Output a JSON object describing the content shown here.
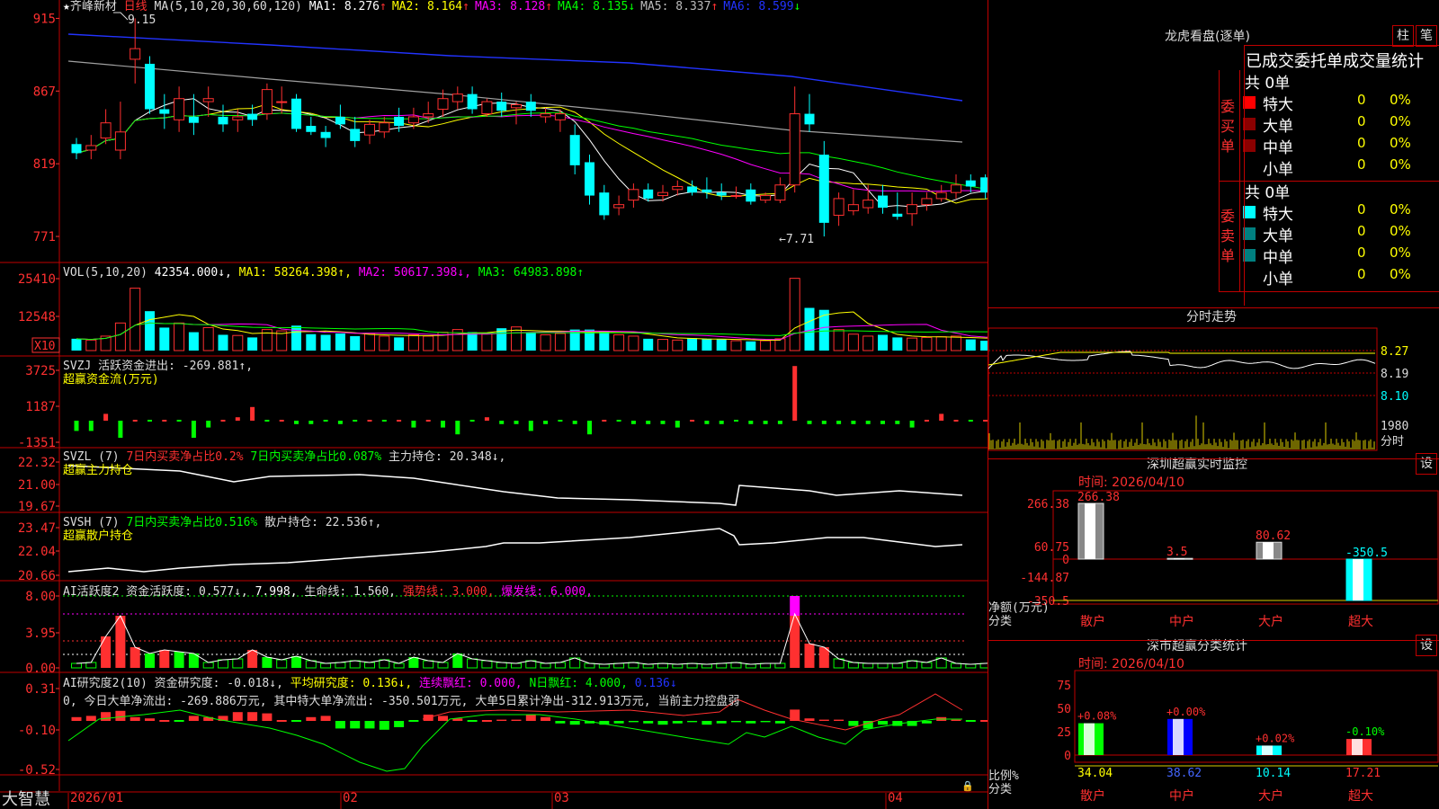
{
  "colors": {
    "up": "#ff3030",
    "down": "#00ffff",
    "border": "#c00000",
    "yellow": "#ffff00",
    "magenta": "#ff00ff",
    "green": "#00ff00",
    "white": "#ffffff",
    "blue": "#2233ff",
    "gray": "#a0a0a0"
  },
  "header": {
    "star": "★",
    "stock_name": "齐峰新材",
    "period": "日线",
    "ma_params": "MA(5,10,20,30,60,120)",
    "ma": [
      {
        "label": "MA1:",
        "value": "8.276",
        "arrow": "↑",
        "color": "#ffffff"
      },
      {
        "label": "MA2:",
        "value": "8.164",
        "arrow": "↑",
        "color": "#ffff00"
      },
      {
        "label": "MA3:",
        "value": "8.128",
        "arrow": "↑",
        "color": "#ff00ff"
      },
      {
        "label": "MA4:",
        "value": "8.135",
        "arrow": "↓",
        "color": "#00ff00"
      },
      {
        "label": "MA5:",
        "value": "8.337",
        "arrow": "↑",
        "color": "#bbbbbb"
      },
      {
        "label": "MA6:",
        "value": "8.599",
        "arrow": "↓",
        "color": "#2233ff"
      }
    ]
  },
  "axes": {
    "price_ticks": [
      "915",
      "867",
      "819",
      "771"
    ],
    "vol_ticks": [
      "25410",
      "12548"
    ],
    "vol_unit": "X10",
    "svzj_ticks": [
      "3725",
      "1187",
      "-1351"
    ],
    "svzl_ticks": [
      "22.32",
      "21.00",
      "19.67"
    ],
    "svsh_ticks": [
      "23.47",
      "22.04",
      "20.66"
    ],
    "ai_ticks": [
      "8.00",
      "3.95",
      "0.00"
    ],
    "ai2_ticks": [
      "0.31",
      "-0.10",
      "-0.52"
    ],
    "dates": [
      "2026/01",
      "02",
      "03",
      "04"
    ]
  },
  "annotations": {
    "high": "9.15",
    "low": "←7.71"
  },
  "panels": {
    "vol": {
      "params": "VOL(5,10,20)",
      "value": "42354.000↓,",
      "ma": [
        {
          "t": "MA1: 58264.398↑,",
          "c": "#ffff00"
        },
        {
          "t": "MA2: 50617.398↓,",
          "c": "#ff00ff"
        },
        {
          "t": "MA3: 64983.898↑",
          "c": "#00ff00"
        }
      ]
    },
    "svzj": {
      "line1": "SVZJ  活跃资金进出: -269.881↑,",
      "line2": "超赢资金流(万元)"
    },
    "svzl": {
      "p1": "SVZL (7)",
      "p2": "7日内买卖净占比0.2%",
      "p3": "7日内买卖净占比0.087%",
      "p4": "主力持仓: 20.348↓,",
      "line2": "超赢主力持仓"
    },
    "svsh": {
      "p1": "SVSH (7)",
      "p2": "7日内买卖净占比0.516%",
      "p3": "散户持仓: 22.536↑,",
      "line2": "超赢散户持仓"
    },
    "ai": {
      "p1": "AI活跃度2",
      "p2": "资金活跃度: 0.577↓,",
      "p3": "7.998,",
      "p4": "生命线: 1.560,",
      "p5": "强势线: 3.000,",
      "p6": "爆发线: 6.000,"
    },
    "ai2": {
      "p1": "AI研究度2(10)",
      "p2": "资金研究度: -0.018↓,",
      "p3": "平均研究度: 0.136↓,",
      "p4": "连续飘红: 0.000,",
      "p5": "N日飘红: 4.000,",
      "p6": "0.136↓",
      "line2": "0, 今日大单净流出: -269.886万元, 其中特大单净流出: -350.501万元, 大单5日累计净出-312.913万元, 当前主力控盘弱"
    }
  },
  "footer": {
    "brand": "大智慧"
  },
  "right": {
    "lhb": {
      "title": "龙虎看盘(逐单)",
      "btn1": "柱",
      "btn2": "笔",
      "tabs": "已成交委托单成交量统计",
      "buy": {
        "label": "委买单",
        "total": "共 0单",
        "rows": [
          {
            "name": "特大",
            "v": "0",
            "p": "0%"
          },
          {
            "name": "大单",
            "v": "0",
            "p": "0%"
          },
          {
            "name": "中单",
            "v": "0",
            "p": "0%"
          },
          {
            "name": "小单",
            "v": "0",
            "p": "0%"
          }
        ]
      },
      "sell": {
        "label": "委卖单",
        "total": "共 0单",
        "rows": [
          {
            "name": "特大",
            "v": "0",
            "p": "0%"
          },
          {
            "name": "大单",
            "v": "0",
            "p": "0%"
          },
          {
            "name": "中单",
            "v": "0",
            "p": "0%"
          },
          {
            "name": "小单",
            "v": "0",
            "p": "0%"
          }
        ]
      }
    },
    "fenshi": {
      "title": "分时走势",
      "ticks": [
        "8.27",
        "8.19",
        "8.10"
      ],
      "vol": "1980",
      "vol_label": "分时"
    },
    "szmon": {
      "title": "深圳超赢实时监控",
      "btn": "设",
      "time": "时间: 2026/04/10",
      "ylabels": [
        "266.38",
        "60.75",
        "0",
        "-144.87",
        "-350.5"
      ],
      "bars": [
        {
          "label": "266.38",
          "value": 266.38
        },
        {
          "label": "3.5",
          "value": 3.5
        },
        {
          "label": "80.62",
          "value": 80.62
        },
        {
          "label": "-350.5",
          "value": -350.5
        }
      ],
      "ylab1": "净额(万元)",
      "ylab2": "分类",
      "cats": [
        "散户",
        "中户",
        "大户",
        "超大"
      ]
    },
    "szstat": {
      "title": "深市超赢分类统计",
      "btn": "设",
      "time": "时间: 2026/04/10",
      "ylabels": [
        "75",
        "50",
        "25",
        "0"
      ],
      "bars": [
        {
          "pct": "+0.08%",
          "value": 34.04,
          "label": "34.04"
        },
        {
          "pct": "+0.00%",
          "value": 38.62,
          "label": "38.62"
        },
        {
          "pct": "+0.02%",
          "value": 10.14,
          "label": "10.14"
        },
        {
          "pct": "-0.10%",
          "value": 17.21,
          "label": "17.21"
        }
      ],
      "ylab1": "比例%",
      "ylab2": "分类",
      "cats": [
        "散户",
        "中户",
        "大户",
        "超大"
      ]
    }
  },
  "chart_data": [
    {
      "type": "candlestick",
      "title": "齐峰新材 日线",
      "y_range": [
        7.55,
        9.2
      ],
      "ohlc": [
        [
          8.32,
          8.36,
          8.22,
          8.26
        ],
        [
          8.28,
          8.38,
          8.22,
          8.31
        ],
        [
          8.36,
          8.55,
          8.32,
          8.46
        ],
        [
          8.28,
          8.6,
          8.22,
          8.4
        ],
        [
          8.88,
          9.15,
          8.72,
          8.95
        ],
        [
          8.85,
          8.9,
          8.52,
          8.55
        ],
        [
          8.55,
          8.65,
          8.42,
          8.52
        ],
        [
          8.48,
          8.7,
          8.4,
          8.62
        ],
        [
          8.5,
          8.65,
          8.38,
          8.46
        ],
        [
          8.6,
          8.7,
          8.5,
          8.62
        ],
        [
          8.5,
          8.58,
          8.4,
          8.45
        ],
        [
          8.48,
          8.55,
          8.4,
          8.5
        ],
        [
          8.52,
          8.58,
          8.44,
          8.48
        ],
        [
          8.52,
          8.72,
          8.48,
          8.68
        ],
        [
          8.6,
          8.7,
          8.52,
          8.6
        ],
        [
          8.62,
          8.65,
          8.4,
          8.42
        ],
        [
          8.44,
          8.5,
          8.38,
          8.4
        ],
        [
          8.4,
          8.44,
          8.3,
          8.36
        ],
        [
          8.5,
          8.58,
          8.42,
          8.45
        ],
        [
          8.42,
          8.5,
          8.3,
          8.34
        ],
        [
          8.38,
          8.48,
          8.32,
          8.45
        ],
        [
          8.4,
          8.5,
          8.36,
          8.46
        ],
        [
          8.5,
          8.56,
          8.4,
          8.44
        ],
        [
          8.46,
          8.56,
          8.42,
          8.5
        ],
        [
          8.5,
          8.6,
          8.46,
          8.52
        ],
        [
          8.55,
          8.68,
          8.5,
          8.62
        ],
        [
          8.6,
          8.7,
          8.55,
          8.65
        ],
        [
          8.65,
          8.7,
          8.52,
          8.55
        ],
        [
          8.52,
          8.62,
          8.5,
          8.6
        ],
        [
          8.6,
          8.66,
          8.5,
          8.54
        ],
        [
          8.56,
          8.6,
          8.45,
          8.58
        ],
        [
          8.6,
          8.65,
          8.5,
          8.54
        ],
        [
          8.5,
          8.56,
          8.46,
          8.52
        ],
        [
          8.48,
          8.55,
          8.4,
          8.52
        ],
        [
          8.38,
          8.45,
          8.12,
          8.18
        ],
        [
          8.2,
          8.25,
          7.92,
          7.98
        ],
        [
          8.0,
          8.05,
          7.82,
          7.85
        ],
        [
          7.9,
          7.98,
          7.85,
          7.92
        ],
        [
          7.95,
          8.06,
          7.9,
          8.02
        ],
        [
          8.02,
          8.06,
          7.94,
          7.96
        ],
        [
          7.98,
          8.05,
          7.94,
          8.0
        ],
        [
          8.02,
          8.08,
          7.98,
          8.04
        ],
        [
          8.04,
          8.08,
          7.98,
          8.0
        ],
        [
          8.02,
          8.1,
          7.96,
          8.0
        ],
        [
          8.0,
          8.06,
          7.95,
          7.98
        ],
        [
          7.98,
          8.04,
          7.96,
          7.98
        ],
        [
          8.02,
          8.06,
          7.92,
          7.94
        ],
        [
          7.95,
          8.0,
          7.93,
          7.98
        ],
        [
          7.95,
          8.1,
          7.93,
          8.05
        ],
        [
          8.05,
          8.7,
          8.0,
          8.52
        ],
        [
          8.52,
          8.65,
          8.4,
          8.45
        ],
        [
          8.25,
          8.34,
          7.71,
          7.8
        ],
        [
          7.85,
          8.0,
          7.78,
          7.96
        ],
        [
          7.88,
          8.02,
          7.85,
          7.92
        ],
        [
          7.9,
          8.05,
          7.86,
          7.95
        ],
        [
          7.98,
          8.05,
          7.86,
          7.9
        ],
        [
          7.86,
          8.0,
          7.82,
          7.84
        ],
        [
          7.86,
          8.0,
          7.78,
          7.92
        ],
        [
          7.92,
          8.0,
          7.88,
          7.96
        ],
        [
          7.96,
          8.05,
          7.94,
          8.0
        ],
        [
          8.0,
          8.12,
          7.96,
          8.05
        ],
        [
          8.08,
          8.12,
          8.0,
          8.04
        ],
        [
          8.1,
          8.12,
          7.96,
          8.0
        ],
        [
          8.04,
          8.14,
          7.9,
          8.02
        ],
        [
          8.06,
          8.2,
          8.02,
          8.12
        ],
        [
          8.12,
          8.22,
          8.05,
          8.15
        ],
        [
          8.15,
          8.45,
          8.1,
          8.25
        ],
        [
          8.25,
          8.3,
          8.15,
          8.2
        ],
        [
          8.3,
          8.4,
          8.18,
          8.22
        ],
        [
          8.32,
          8.38,
          8.05,
          8.1
        ],
        [
          8.1,
          8.22,
          8.08,
          8.18
        ]
      ],
      "volume": [
        1800,
        1600,
        2200,
        4200,
        9500,
        6000,
        3500,
        4200,
        2800,
        3500,
        2400,
        2300,
        2000,
        3200,
        3000,
        3800,
        2500,
        2400,
        2600,
        2200,
        2600,
        2200,
        2000,
        2400,
        2200,
        2800,
        3200,
        2800,
        2600,
        3400,
        3600,
        2800,
        2400,
        2600,
        3200,
        3200,
        3000,
        2400,
        2200,
        1800,
        1700,
        1600,
        1900,
        1800,
        1700,
        1500,
        1400,
        1500,
        1800,
        11000,
        6500,
        6200,
        3200,
        2500,
        2200,
        2400,
        2000,
        1900,
        2000,
        2100,
        2200,
        1700,
        1500,
        1800,
        1900,
        1800,
        2200,
        2000,
        2100,
        2000,
        1900
      ]
    },
    {
      "type": "line",
      "title": "分时走势",
      "y_range": [
        8.02,
        8.33
      ]
    },
    {
      "type": "bar",
      "title": "深圳超赢实时监控",
      "categories": [
        "散户",
        "中户",
        "大户",
        "超大"
      ],
      "values": [
        266.38,
        3.5,
        80.62,
        -350.5
      ]
    },
    {
      "type": "bar",
      "title": "深市超赢分类统计",
      "categories": [
        "散户",
        "中户",
        "大户",
        "超大"
      ],
      "values": [
        34.04,
        38.62,
        10.14,
        17.21
      ],
      "ylim": [
        0,
        75
      ]
    }
  ]
}
